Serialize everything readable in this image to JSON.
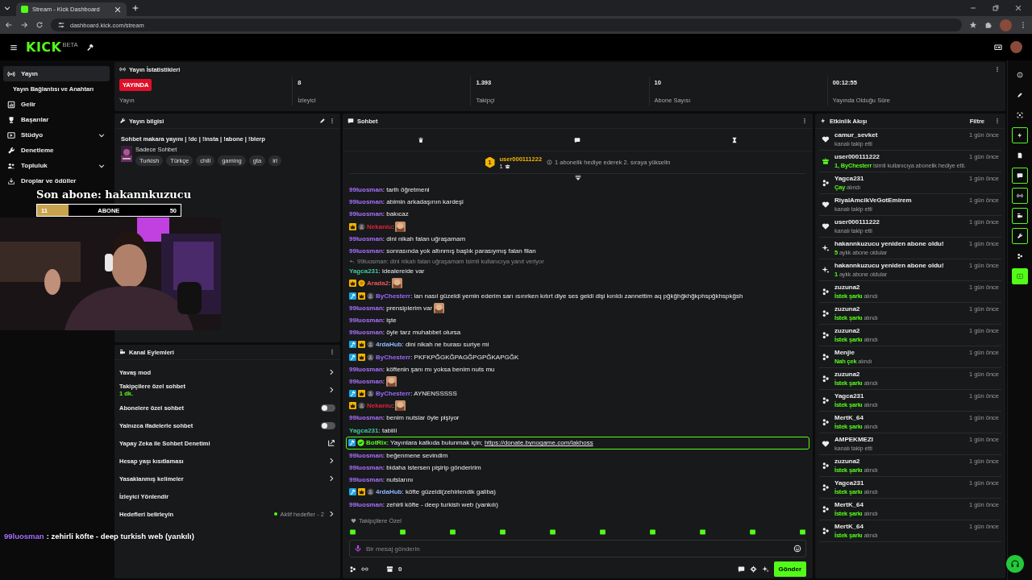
{
  "browser": {
    "tab_title": "Stream - Kick Dashboard",
    "url": "dashboard.kick.com/stream"
  },
  "header": {
    "logo": "KICK",
    "logo_tag": "BETA"
  },
  "sidebar": {
    "items": [
      {
        "label": "Yayın",
        "kind": "link",
        "selected": true,
        "children": [
          {
            "label": "Yayın Bağlantısı ve Anahtarı",
            "selected": false
          }
        ]
      },
      {
        "label": "Gelir",
        "kind": "link",
        "selected": false
      },
      {
        "label": "Başarılar",
        "kind": "link",
        "selected": false
      },
      {
        "label": "Stüdyo",
        "kind": "group",
        "selected": false,
        "expanded": false
      },
      {
        "label": "Denetleme",
        "kind": "link",
        "selected": false
      },
      {
        "label": "Topluluk",
        "kind": "group",
        "selected": false,
        "expanded": false
      },
      {
        "label": "Droplar ve ödüller",
        "kind": "link",
        "selected": false
      }
    ]
  },
  "stats": {
    "title": "Yayın İstatistikleri",
    "items": [
      {
        "kind": "badge",
        "value": "YAYINDA",
        "label": "Yayın"
      },
      {
        "kind": "number",
        "value": "8",
        "label": "İzleyici"
      },
      {
        "kind": "number",
        "value": "1.393",
        "label": "Takipçi"
      },
      {
        "kind": "number",
        "value": "10",
        "label": "Abone Sayısı"
      },
      {
        "kind": "number",
        "value": "00:12:55",
        "label": "Yayında Olduğu Süre"
      }
    ]
  },
  "stream_info": {
    "title": "Yayın bilgisi",
    "stream_title": "Sohbet makara yayını | !dc | !insta | !abone | !blerp",
    "category": "Sadece Sohbet",
    "tags": [
      "Turkish",
      "Türkçe",
      "chill",
      "gaming",
      "gta",
      "irl"
    ]
  },
  "channel_actions": {
    "title": "Kanal Eylemleri",
    "items": [
      {
        "kind": "chevron",
        "label": "Yavaş mod"
      },
      {
        "kind": "chevron",
        "label": "Takipçilere özel sohbet",
        "sub": "1 dk."
      },
      {
        "kind": "toggle",
        "label": "Abonelere özel sohbet",
        "on": false
      },
      {
        "kind": "toggle",
        "label": "Yalnızca ifadelerle sohbet",
        "on": false
      },
      {
        "kind": "external",
        "label": "Yapay Zeka ile Sohbet Denetimi"
      },
      {
        "kind": "chevron",
        "label": "Hesap yaşı kısıtlaması"
      },
      {
        "kind": "chevron",
        "label": "Yasaklanmış kelimeler"
      },
      {
        "kind": "plain",
        "label": "İzleyici Yönlendir"
      },
      {
        "kind": "chevron",
        "label": "Hedefleri belirleyin",
        "status": "Aktif hedefler - 2"
      }
    ]
  },
  "chat": {
    "title": "Sohbet",
    "top_gifter": {
      "rank": "1",
      "name": "user000111222",
      "count": "1",
      "hint": "1 abonelik hediye ederek 2. sıraya yükselin"
    },
    "messages": [
      {
        "user": "99luosman",
        "color": "#a970ff",
        "text": ": tarih öğretmeni"
      },
      {
        "user": "99luosman",
        "color": "#a970ff",
        "text": ": abimin arkadaşının kardeşi"
      },
      {
        "user": "99luosman",
        "color": "#a970ff",
        "text": ": bakıcaz"
      },
      {
        "user": "Nekaniu",
        "color": "#e0223a",
        "badges": [
          {
            "kind": "crown"
          },
          {
            "kind": "avatar"
          }
        ],
        "text": ":",
        "emote": true
      },
      {
        "user": "99luosman",
        "color": "#a970ff",
        "text": ": dini nikah falan uğraşamam"
      },
      {
        "user": "99luosman",
        "color": "#a970ff",
        "text": ": sonrasında yok altınmış başlık parasıymış falan filan"
      },
      {
        "user": "Yagca231",
        "color": "#3fc89a",
        "text": ": idealereide var",
        "reply": "99luosman: dini nikah falan uğraşamam isimli kullanıcıya yanıt veriyor"
      },
      {
        "user": "Arada2",
        "color": "#e85a5a",
        "badges": [
          {
            "kind": "crown"
          },
          {
            "kind": "coin"
          }
        ],
        "text": ":",
        "emote": true
      },
      {
        "user": "ByChesterr",
        "color": "#9b6bff",
        "badges": [
          {
            "kind": "mod"
          },
          {
            "kind": "crown"
          },
          {
            "kind": "avatar"
          }
        ],
        "text": ": lan nasıl güzeldi yemin ederim sarı ısırırken kıtırt diye ses geldi dişi kırıldı zannettim aq pğkğhğkhğkphspğkhspkğsh"
      },
      {
        "user": "99luosman",
        "color": "#a970ff",
        "text": ": prensiplerim var",
        "emote": true
      },
      {
        "user": "99luosman",
        "color": "#a970ff",
        "text": ": işte"
      },
      {
        "user": "99luosman",
        "color": "#a970ff",
        "text": ": öyle tarz muhabbet olursa"
      },
      {
        "user": "4rdaHub",
        "color": "#8fb8ff",
        "badges": [
          {
            "kind": "mod"
          },
          {
            "kind": "crown"
          },
          {
            "kind": "avatar"
          }
        ],
        "text": ": dini nikah ne burası suriye mi"
      },
      {
        "user": "ByChesterr",
        "color": "#9b6bff",
        "badges": [
          {
            "kind": "mod"
          },
          {
            "kind": "crown"
          },
          {
            "kind": "avatar"
          }
        ],
        "text": ": PKFKPĞGKĞPAGĞPGPĞKAPGĞK"
      },
      {
        "user": "99luosman",
        "color": "#a970ff",
        "text": ": köftenin şanı mı yoksa benim nuts mu"
      },
      {
        "user": "99luosman",
        "color": "#a970ff",
        "text": ":",
        "emote": true
      },
      {
        "user": "ByChesterr",
        "color": "#9b6bff",
        "badges": [
          {
            "kind": "mod"
          },
          {
            "kind": "crown"
          },
          {
            "kind": "avatar"
          }
        ],
        "text": ": AYNENSSSSS"
      },
      {
        "user": "Nekaniu",
        "color": "#e0223a",
        "badges": [
          {
            "kind": "crown"
          },
          {
            "kind": "avatar"
          }
        ],
        "text": ":",
        "emote": true
      },
      {
        "user": "99luosman",
        "color": "#a970ff",
        "text": ": benim nutslar öyle pişiyor"
      },
      {
        "user": "Yagca231",
        "color": "#3fc89a",
        "text": ": tabiiii"
      },
      {
        "user": "BotRix",
        "color": "#53fc18",
        "badges": [
          {
            "kind": "mod"
          },
          {
            "kind": "verified"
          }
        ],
        "text": ": Yayınlara katkıda bulunmak için;",
        "link": "https://donate.bynogame.com/lakhoss",
        "highlighted": true
      },
      {
        "user": "99luosman",
        "color": "#a970ff",
        "text": ": beğenmene sevindim"
      },
      {
        "user": "99luosman",
        "color": "#a970ff",
        "text": ": bidaha istersen pişirip gönderirim"
      },
      {
        "user": "99luosman",
        "color": "#a970ff",
        "text": ": nutslarını"
      },
      {
        "user": "4rdaHub",
        "color": "#8fb8ff",
        "badges": [
          {
            "kind": "mod"
          },
          {
            "kind": "crown"
          },
          {
            "kind": "avatar"
          }
        ],
        "text": ": köfte güzeldi(zehirlendik galiba)"
      },
      {
        "user": "99luosman",
        "color": "#a970ff",
        "text": ": zehirli köfte - deep turkish web (yankılı)"
      }
    ],
    "mode": "Takipçilere Özel",
    "placeholder": "Bir mesaj gönderin",
    "store_count": "0",
    "send": "Gönder"
  },
  "activity": {
    "title": "Etkinlik Akışı",
    "filter": "Filtre",
    "items": [
      {
        "kind": "follow",
        "user": "camur_sevket",
        "detail": "kanalı takip etti",
        "time": "1 gün önce"
      },
      {
        "kind": "gift",
        "user": "user000111222",
        "highlight": "1, ByChesterr",
        "detail": "isimli kullanıcıya abonelik hediye etti.",
        "time": "1 gün önce"
      },
      {
        "kind": "redeem",
        "user": "Yagca231",
        "highlight": "Çay",
        "detail": "alındı",
        "time": "1 gün önce"
      },
      {
        "kind": "follow",
        "user": "RiyalAmcikVeGotEmirem",
        "detail": "kanalı takip etti",
        "time": "1 gün önce"
      },
      {
        "kind": "follow",
        "user": "user000111222",
        "detail": "kanalı takip etti",
        "time": "1 gün önce"
      },
      {
        "kind": "resub",
        "user": "hakannkuzucu yeniden abone oldu!",
        "highlight": "5",
        "detail": "aylık abone oldular",
        "time": "1 gün önce"
      },
      {
        "kind": "resub",
        "user": "hakannkuzucu yeniden abone oldu!",
        "highlight": "1",
        "detail": "aylık abone oldular",
        "time": "1 gün önce"
      },
      {
        "kind": "redeem",
        "user": "zuzuna2",
        "highlight": "İstek şarkı",
        "detail": "alındı",
        "time": "1 gün önce"
      },
      {
        "kind": "redeem",
        "user": "zuzuna2",
        "highlight": "İstek şarkı",
        "detail": "alındı",
        "time": "1 gün önce"
      },
      {
        "kind": "redeem",
        "user": "zuzuna2",
        "highlight": "İstek şarkı",
        "detail": "alındı",
        "time": "1 gün önce"
      },
      {
        "kind": "redeem",
        "user": "Menjie",
        "highlight": "Nah çek",
        "detail": "alındı",
        "time": "1 gün önce"
      },
      {
        "kind": "redeem",
        "user": "zuzuna2",
        "highlight": "İstek şarkı",
        "detail": "alındı",
        "time": "1 gün önce"
      },
      {
        "kind": "redeem",
        "user": "Yagca231",
        "highlight": "İstek şarkı",
        "detail": "alındı",
        "time": "1 gün önce"
      },
      {
        "kind": "redeem",
        "user": "MertK_64",
        "highlight": "İstek şarkı",
        "detail": "alındı",
        "time": "1 gün önce"
      },
      {
        "kind": "follow",
        "user": "AMPEKMEZI",
        "detail": "kanalı takip etti",
        "time": "1 gün önce"
      },
      {
        "kind": "redeem",
        "user": "zuzuna2",
        "highlight": "İstek şarkı",
        "detail": "alındı",
        "time": "1 gün önce"
      },
      {
        "kind": "redeem",
        "user": "Yagca231",
        "highlight": "İstek şarkı",
        "detail": "alındı",
        "time": "1 gün önce"
      },
      {
        "kind": "redeem",
        "user": "MertK_64",
        "highlight": "İstek şarkı",
        "detail": "alındı",
        "time": "1 gün önce"
      },
      {
        "kind": "redeem",
        "user": "MertK_64",
        "highlight": "İstek şarkı",
        "detail": "alındı",
        "time": "1 gün önce"
      }
    ]
  },
  "rail": [
    {
      "on": false
    },
    {
      "on": false
    },
    {
      "on": false
    },
    {
      "on": true
    },
    {
      "on": false
    },
    {
      "on": true
    },
    {
      "on": true
    },
    {
      "on": true
    },
    {
      "on": true
    },
    {
      "on": false
    },
    {
      "kind": "filled"
    }
  ],
  "overlay": {
    "last_sub": "Son abone: hakannkuzucu",
    "goal": {
      "current": "11",
      "label": "ABONE",
      "target": "50",
      "level": 0.22
    },
    "caption": {
      "user": "99luosman",
      "text": ": zehirli köfte - deep turkish web (yankılı)"
    }
  }
}
